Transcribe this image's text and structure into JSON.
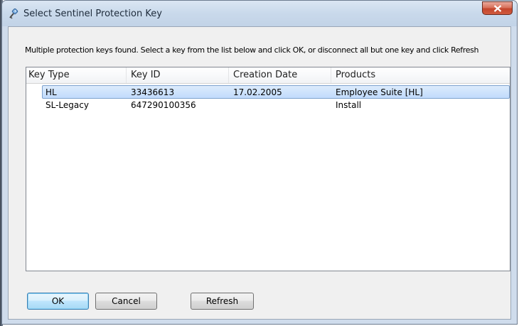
{
  "window": {
    "title": "Select Sentinel Protection Key",
    "close_label": "X"
  },
  "message": "Multiple protection keys found. Select a key from the list below and click OK, or disconnect all but one key and click Refresh",
  "list": {
    "columns": [
      "Key Type",
      "Key ID",
      "Creation Date",
      "Products"
    ],
    "rows": [
      {
        "key_type": "HL",
        "key_id": "33436613",
        "creation_date": "17.02.2005",
        "products": "Employee Suite [HL]",
        "selected": true
      },
      {
        "key_type": "SL-Legacy",
        "key_id": "647290100356",
        "creation_date": "",
        "products": "Install",
        "selected": false
      }
    ]
  },
  "buttons": {
    "ok": "OK",
    "cancel": "Cancel",
    "refresh": "Refresh"
  },
  "colors": {
    "titlebar": "#c9d9eb",
    "client_bg": "#f0f0f0",
    "selection": "#c1dbfc",
    "selection_border": "#7da2ce",
    "close_button": "#c4452c"
  },
  "icons": {
    "app": "key-icon",
    "close": "close-icon"
  }
}
